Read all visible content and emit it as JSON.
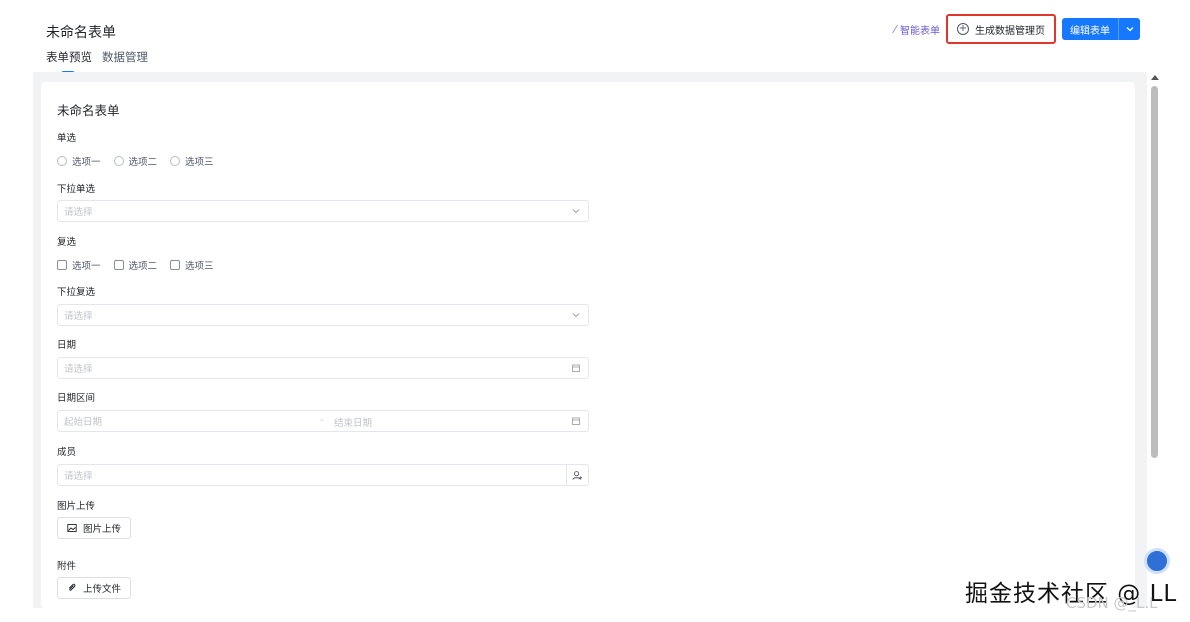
{
  "header": {
    "title": "未命名表单",
    "tabs": [
      {
        "label": "表单预览",
        "active": true
      },
      {
        "label": "数据管理",
        "active": false
      }
    ],
    "smart_form": "智能表单",
    "generate_button": "生成数据管理页",
    "edit_button": "编辑表单"
  },
  "form": {
    "title": "未命名表单",
    "radio": {
      "label": "单选",
      "options": [
        "选项一",
        "选项二",
        "选项三"
      ]
    },
    "select": {
      "label": "下拉单选",
      "placeholder": "请选择"
    },
    "checkbox": {
      "label": "复选",
      "options": [
        "选项一",
        "选项二",
        "选项三"
      ]
    },
    "multi_select": {
      "label": "下拉复选",
      "placeholder": "请选择"
    },
    "date": {
      "label": "日期",
      "placeholder": "请选择"
    },
    "date_range": {
      "label": "日期区间",
      "start_placeholder": "起始日期",
      "separator": "-",
      "end_placeholder": "结束日期"
    },
    "member": {
      "label": "成员",
      "placeholder": "请选择"
    },
    "image_upload": {
      "label": "图片上传",
      "button": "图片上传"
    },
    "attachment": {
      "label": "附件",
      "button": "上传文件"
    }
  },
  "watermark": {
    "main": "掘金技术社区 @ LL",
    "sub": "CSDN @_L.L"
  },
  "colors": {
    "primary": "#1677ff",
    "highlight_border": "#e0362c",
    "smart_purple": "#6b5bd6"
  },
  "icons": [
    "magic-wand-icon",
    "plus-circle-icon",
    "chevron-down-icon",
    "calendar-icon",
    "user-add-icon",
    "image-icon",
    "paperclip-icon"
  ]
}
